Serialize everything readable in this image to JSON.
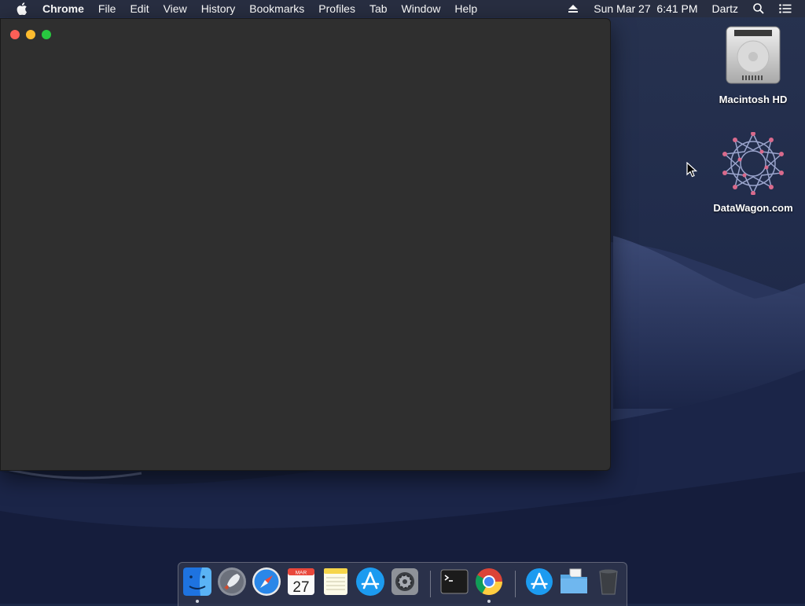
{
  "menubar": {
    "app_name": "Chrome",
    "items": [
      "File",
      "Edit",
      "View",
      "History",
      "Bookmarks",
      "Profiles",
      "Tab",
      "Window",
      "Help"
    ],
    "datetime": "Sun Mar 27  6:41 PM",
    "user": "Dartz"
  },
  "desktop": {
    "icons": [
      {
        "label": "Macintosh HD",
        "icon": "hard-drive-icon"
      },
      {
        "label": "DataWagon.com",
        "icon": "network-star-icon"
      }
    ]
  },
  "dock": {
    "calendar_month": "MAR",
    "calendar_day": "27",
    "apps": [
      "finder",
      "launchpad",
      "safari",
      "calendar",
      "notes",
      "app-store",
      "system-preferences",
      "terminal",
      "chrome",
      "applications-folder",
      "documents-folder",
      "trash"
    ]
  },
  "colors": {
    "menubar": "#282e40",
    "window": "#2f2f2f",
    "close": "#fd5f57",
    "minimize": "#febc2e",
    "maximize": "#28c840"
  }
}
